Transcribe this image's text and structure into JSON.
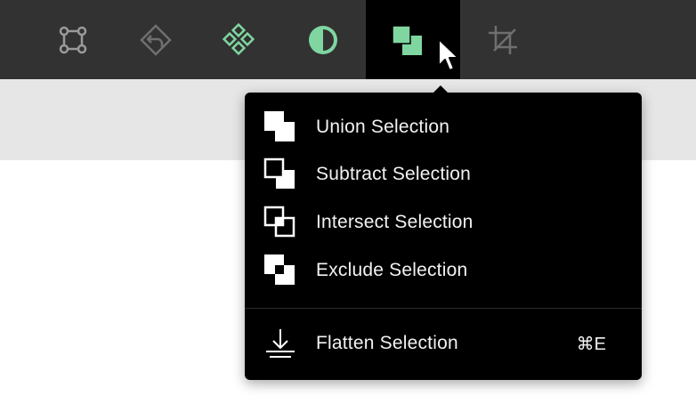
{
  "toolbar": {
    "tools": [
      {
        "name": "transform-tool",
        "icon": "transform-icon"
      },
      {
        "name": "undo-tool",
        "icon": "undo-arrow-icon"
      },
      {
        "name": "components-tool",
        "icon": "components-icon"
      },
      {
        "name": "contrast-tool",
        "icon": "contrast-icon"
      },
      {
        "name": "boolean-selection-tool",
        "icon": "union-selection-icon",
        "active": true
      },
      {
        "name": "crop-tool",
        "icon": "crop-icon"
      }
    ],
    "accent_color": "#7fd6a0"
  },
  "menu": {
    "items": [
      {
        "label": "Union Selection",
        "icon": "union-selection-icon"
      },
      {
        "label": "Subtract Selection",
        "icon": "subtract-selection-icon"
      },
      {
        "label": "Intersect Selection",
        "icon": "intersect-selection-icon"
      },
      {
        "label": "Exclude Selection",
        "icon": "exclude-selection-icon"
      }
    ],
    "flatten": {
      "label": "Flatten Selection",
      "shortcut": "⌘E",
      "icon": "flatten-icon"
    }
  }
}
